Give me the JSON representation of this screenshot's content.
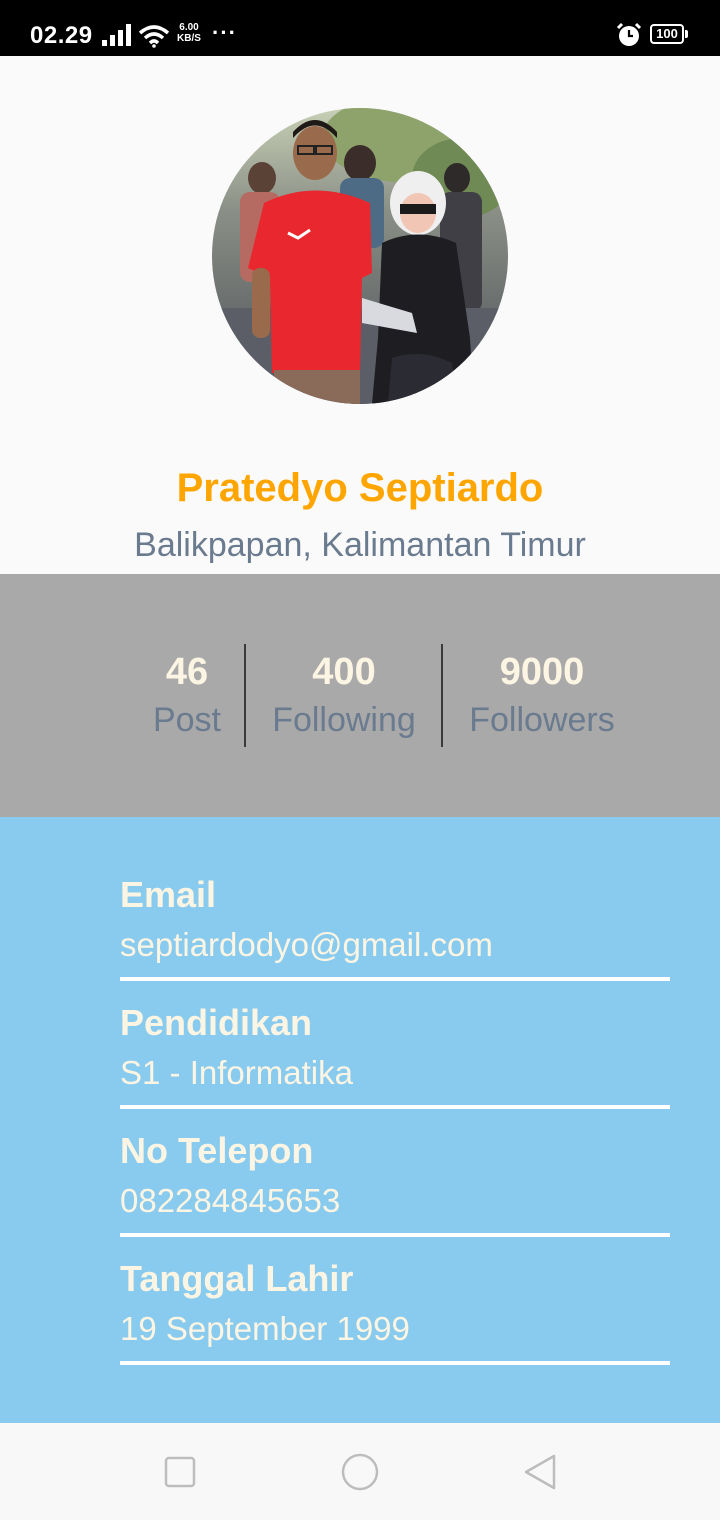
{
  "status_bar": {
    "time": "02.29",
    "net_speed_value": "6.00",
    "net_speed_unit": "KB/S",
    "more": "···",
    "battery": "100",
    "icons": [
      "signal-icon",
      "wifi-icon",
      "alarm-icon",
      "battery-icon"
    ]
  },
  "profile": {
    "name": "Pratedyo Septiardo",
    "location": "Balikpapan, Kalimantan Timur",
    "name_color": "#FFA500"
  },
  "stats": [
    {
      "value": "46",
      "label": "Post"
    },
    {
      "value": "400",
      "label": "Following"
    },
    {
      "value": "9000",
      "label": "Followers"
    }
  ],
  "details": [
    {
      "label": "Email",
      "value": "septiardodyo@gmail.com"
    },
    {
      "label": "Pendidikan",
      "value": "S1 - Informatika"
    },
    {
      "label": "No Telepon",
      "value": "082284845653"
    },
    {
      "label": "Tanggal Lahir",
      "value": "19 September 1999"
    }
  ],
  "colors": {
    "stats_background": "#a9a9a9",
    "details_background": "#89cbee",
    "text_light": "#fdf5e3",
    "text_muted": "#6b7b8f"
  },
  "nav_bar": {
    "icons": [
      "recents-square-icon",
      "home-circle-icon",
      "back-triangle-icon"
    ]
  }
}
